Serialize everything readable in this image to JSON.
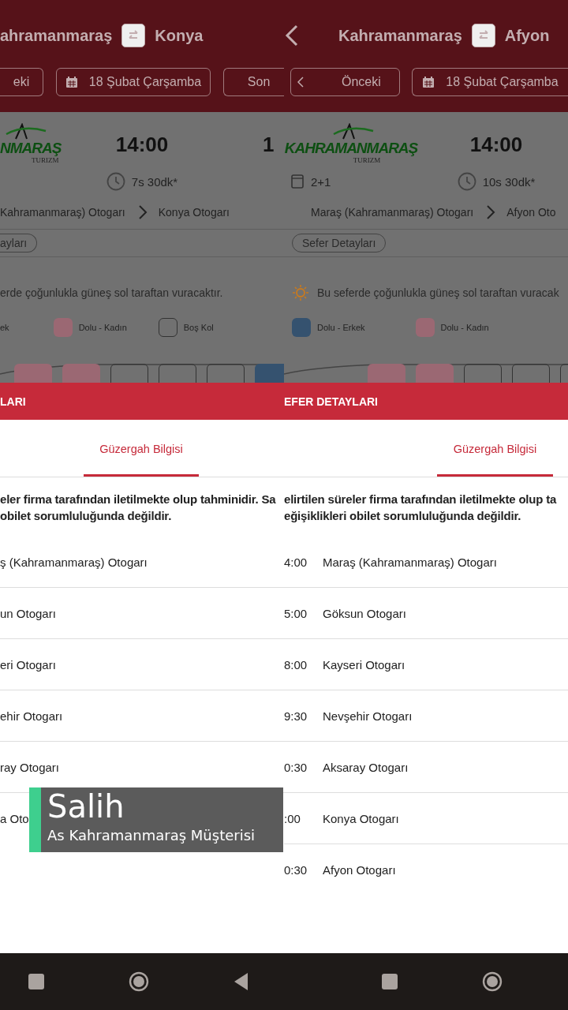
{
  "panels": [
    {
      "header": {
        "back": false,
        "from": "ahramanmaraş",
        "to": "Konya"
      },
      "date_bar": {
        "prev": {
          "label": "eki",
          "chevron": false
        },
        "date": "18 Şubat Çarşamba",
        "next": "Son"
      },
      "trip": {
        "logo": {
          "name": "NMARAŞ",
          "sub": "TURIZM"
        },
        "departure": "14:00",
        "next_time": "1",
        "duration": "7s 30dk*",
        "route": {
          "from": "Kahramanmaraş) Otogarı",
          "to": "Konya Otogarı"
        },
        "details_button": "ayları"
      },
      "sun_note": {
        "icon": false,
        "text": "erde çoğunlukla güneş sol taraftan vuracaktır."
      },
      "legend": [
        {
          "kind": "text",
          "label": "ek"
        },
        {
          "kind": "female",
          "label": "Dolu - Kadın"
        },
        {
          "kind": "empty",
          "label": "Boş Kol"
        }
      ],
      "seats": [
        {
          "kind": "female"
        },
        {
          "kind": "female"
        },
        {
          "kind": "empty"
        },
        {
          "kind": "empty"
        },
        {
          "kind": "empty"
        },
        {
          "kind": "male"
        }
      ],
      "sheet": {
        "title": "LARI",
        "tabs": [
          {
            "label": "Güzergah Bilgisi",
            "selected": true
          }
        ],
        "note": [
          "eler firma tarafından iletilmekte olup tahminidir. Sa",
          "obilet sorumluluğunda değildir."
        ],
        "stops": [
          {
            "name": "ş (Kahramanmaraş) Otogarı"
          },
          {
            "name": "un Otogarı"
          },
          {
            "name": "eri Otogarı"
          },
          {
            "name": "ehir Otogarı"
          },
          {
            "name": "ray Otogarı"
          },
          {
            "name": "a Oto"
          }
        ]
      },
      "nav": [
        {
          "kind": "recents"
        },
        {
          "kind": "home"
        },
        {
          "kind": "back"
        }
      ]
    },
    {
      "header": {
        "back": true,
        "from": "Kahramanmaraş",
        "to": "Afyon"
      },
      "date_bar": {
        "prev": {
          "label": "Önceki",
          "chevron": true
        },
        "date": "18 Şubat Çarşamba"
      },
      "trip": {
        "logo": {
          "name": "KAHRAMANMARAŞ",
          "sub": "TURIZM"
        },
        "departure": "14:00",
        "seat_layout": "2+1",
        "duration": "10s 30dk*",
        "route": {
          "from": "Maraş (Kahramanmaraş) Otogarı",
          "to": "Afyon Oto"
        },
        "details_button": "Sefer Detayları"
      },
      "sun_note": {
        "icon": true,
        "text": "Bu seferde çoğunlukla güneş sol taraftan vuracak"
      },
      "legend": [
        {
          "kind": "male",
          "label": "Dolu - Erkek"
        },
        {
          "kind": "female",
          "label": "Dolu - Kadın"
        }
      ],
      "seats": [
        {
          "kind": "female"
        },
        {
          "kind": "female"
        },
        {
          "kind": "empty"
        },
        {
          "kind": "empty"
        },
        {
          "kind": "empty"
        }
      ],
      "sheet": {
        "title": "EFER DETAYLARI",
        "tabs": [
          {
            "label": "Güzergah Bilgisi",
            "selected": true
          }
        ],
        "note": [
          "elirtilen süreler firma tarafından iletilmekte olup ta",
          "eğişiklikleri obilet sorumluluğunda değildir."
        ],
        "stops": [
          {
            "time": "4:00",
            "name": "Maraş (Kahramanmaraş) Otogarı"
          },
          {
            "time": "5:00",
            "name": "Göksun Otogarı"
          },
          {
            "time": "8:00",
            "name": "Kayseri Otogarı"
          },
          {
            "time": "9:30",
            "name": "Nevşehir Otogarı"
          },
          {
            "time": "0:30",
            "name": "Aksaray Otogarı"
          },
          {
            "time": ":00",
            "name": "Konya Otogarı"
          },
          {
            "time": "0:30",
            "name": "Afyon Otogarı"
          }
        ]
      },
      "nav": [
        {
          "kind": "recents"
        },
        {
          "kind": "home"
        }
      ]
    }
  ],
  "caption": {
    "name": "Salih",
    "subtitle": "As Kahramanmaraş Müşterisi"
  }
}
